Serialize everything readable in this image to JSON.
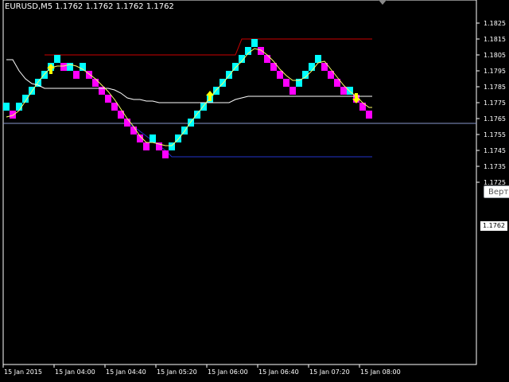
{
  "window": {
    "title": "EURUSD,M5  1.1762 1.1762 1.1762 1.1762",
    "current_price_label": "1.1762",
    "tooltip_text": "Верт"
  },
  "colors": {
    "background": "#000000",
    "axis": "#ffffff",
    "bull_brick": "#00ffff",
    "bear_brick": "#ff00ff",
    "ma_line": "#ffff66",
    "channel_line": "#ffffff",
    "resistance_line": "#cc0000",
    "support_line": "#2233cc",
    "current_price_line": "#8899cc",
    "arrow": "#ffff00"
  },
  "icons": {
    "up_arrow": "up-arrow-icon",
    "down_arrow": "down-arrow-icon",
    "scroll_marker": "scroll-triangle-icon"
  },
  "chart_data": {
    "type": "renko",
    "symbol": "EURUSD",
    "timeframe": "M5",
    "brick_size": 0.0005,
    "ylim": [
      1.1719,
      1.1829
    ],
    "y_ticks": [
      "1.1825",
      "1.1815",
      "1.1805",
      "1.1795",
      "1.1785",
      "1.1775",
      "1.1765",
      "1.1755",
      "1.1745",
      "1.1735",
      "1.1725"
    ],
    "x_ticks": [
      "15 Jan 2015",
      "15 Jan 04:00",
      "15 Jan 04:40",
      "15 Jan 05:20",
      "15 Jan 06:00",
      "15 Jan 06:40",
      "15 Jan 07:20",
      "15 Jan 08:00"
    ],
    "current_price": 1.1762,
    "bricks": [
      {
        "dir": "up",
        "low": 1.177,
        "high": 1.1775
      },
      {
        "dir": "down",
        "low": 1.1765,
        "high": 1.177
      },
      {
        "dir": "up",
        "low": 1.177,
        "high": 1.1775
      },
      {
        "dir": "up",
        "low": 1.1775,
        "high": 1.178
      },
      {
        "dir": "up",
        "low": 1.178,
        "high": 1.1785
      },
      {
        "dir": "up",
        "low": 1.1785,
        "high": 1.179
      },
      {
        "dir": "up",
        "low": 1.179,
        "high": 1.1795
      },
      {
        "dir": "up",
        "low": 1.1795,
        "high": 1.18
      },
      {
        "dir": "up",
        "low": 1.18,
        "high": 1.1805
      },
      {
        "dir": "down",
        "low": 1.1795,
        "high": 1.18
      },
      {
        "dir": "up",
        "low": 1.1795,
        "high": 1.18
      },
      {
        "dir": "down",
        "low": 1.179,
        "high": 1.1795
      },
      {
        "dir": "up",
        "low": 1.1795,
        "high": 1.18
      },
      {
        "dir": "down",
        "low": 1.179,
        "high": 1.1795
      },
      {
        "dir": "down",
        "low": 1.1785,
        "high": 1.179
      },
      {
        "dir": "down",
        "low": 1.178,
        "high": 1.1785
      },
      {
        "dir": "down",
        "low": 1.1775,
        "high": 1.178
      },
      {
        "dir": "down",
        "low": 1.177,
        "high": 1.1775
      },
      {
        "dir": "down",
        "low": 1.1765,
        "high": 1.177
      },
      {
        "dir": "down",
        "low": 1.176,
        "high": 1.1765
      },
      {
        "dir": "down",
        "low": 1.1755,
        "high": 1.176
      },
      {
        "dir": "down",
        "low": 1.175,
        "high": 1.1755
      },
      {
        "dir": "down",
        "low": 1.1745,
        "high": 1.175
      },
      {
        "dir": "up",
        "low": 1.175,
        "high": 1.1755
      },
      {
        "dir": "down",
        "low": 1.1745,
        "high": 1.175
      },
      {
        "dir": "down",
        "low": 1.174,
        "high": 1.1745
      },
      {
        "dir": "up",
        "low": 1.1745,
        "high": 1.175
      },
      {
        "dir": "up",
        "low": 1.175,
        "high": 1.1755
      },
      {
        "dir": "up",
        "low": 1.1755,
        "high": 1.176
      },
      {
        "dir": "up",
        "low": 1.176,
        "high": 1.1765
      },
      {
        "dir": "up",
        "low": 1.1765,
        "high": 1.177
      },
      {
        "dir": "up",
        "low": 1.177,
        "high": 1.1775
      },
      {
        "dir": "up",
        "low": 1.1775,
        "high": 1.178
      },
      {
        "dir": "up",
        "low": 1.178,
        "high": 1.1785
      },
      {
        "dir": "up",
        "low": 1.1785,
        "high": 1.179
      },
      {
        "dir": "up",
        "low": 1.179,
        "high": 1.1795
      },
      {
        "dir": "up",
        "low": 1.1795,
        "high": 1.18
      },
      {
        "dir": "up",
        "low": 1.18,
        "high": 1.1805
      },
      {
        "dir": "up",
        "low": 1.1805,
        "high": 1.181
      },
      {
        "dir": "up",
        "low": 1.181,
        "high": 1.1815
      },
      {
        "dir": "down",
        "low": 1.1805,
        "high": 1.181
      },
      {
        "dir": "down",
        "low": 1.18,
        "high": 1.1805
      },
      {
        "dir": "down",
        "low": 1.1795,
        "high": 1.18
      },
      {
        "dir": "down",
        "low": 1.179,
        "high": 1.1795
      },
      {
        "dir": "down",
        "low": 1.1785,
        "high": 1.179
      },
      {
        "dir": "down",
        "low": 1.178,
        "high": 1.1785
      },
      {
        "dir": "up",
        "low": 1.1785,
        "high": 1.179
      },
      {
        "dir": "up",
        "low": 1.179,
        "high": 1.1795
      },
      {
        "dir": "up",
        "low": 1.1795,
        "high": 1.18
      },
      {
        "dir": "up",
        "low": 1.18,
        "high": 1.1805
      },
      {
        "dir": "down",
        "low": 1.1795,
        "high": 1.18
      },
      {
        "dir": "down",
        "low": 1.179,
        "high": 1.1795
      },
      {
        "dir": "down",
        "low": 1.1785,
        "high": 1.179
      },
      {
        "dir": "down",
        "low": 1.178,
        "high": 1.1785
      },
      {
        "dir": "up",
        "low": 1.178,
        "high": 1.1785
      },
      {
        "dir": "down",
        "low": 1.1775,
        "high": 1.178
      },
      {
        "dir": "down",
        "low": 1.177,
        "high": 1.1775
      },
      {
        "dir": "down",
        "low": 1.1765,
        "high": 1.177
      }
    ],
    "ma": [
      1.1766,
      1.1767,
      1.177,
      1.1776,
      1.1782,
      1.1788,
      1.1793,
      1.1797,
      1.1798,
      1.1798,
      1.1799,
      1.1798,
      1.1796,
      1.1793,
      1.179,
      1.1786,
      1.1782,
      1.1777,
      1.1771,
      1.1765,
      1.176,
      1.1754,
      1.175,
      1.175,
      1.1749,
      1.1748,
      1.1748,
      1.1752,
      1.1757,
      1.1763,
      1.1768,
      1.1773,
      1.1778,
      1.1783,
      1.1787,
      1.1792,
      1.1797,
      1.1801,
      1.1806,
      1.1809,
      1.1808,
      1.1805,
      1.1801,
      1.1796,
      1.1792,
      1.1789,
      1.1789,
      1.1791,
      1.1795,
      1.18,
      1.1801,
      1.1796,
      1.1791,
      1.1786,
      1.1782,
      1.1779,
      1.1775,
      1.1772
    ],
    "channel_upper": [
      1.1831,
      null,
      null,
      null,
      null,
      null,
      1.1805,
      1.1805,
      1.1805,
      1.1805,
      1.1805,
      1.1805,
      1.1805,
      1.1805,
      1.1805,
      1.1805,
      1.1805,
      1.1805,
      1.1805,
      1.1805,
      1.1805,
      1.1805,
      1.1805,
      1.1805,
      1.1805,
      1.1805,
      1.1805,
      1.1805,
      1.1805,
      1.1805,
      1.1805,
      1.1805,
      1.1805,
      1.1805,
      1.1805,
      1.1805,
      1.1805,
      1.1815,
      1.1815,
      1.1815,
      1.1815,
      1.1815,
      1.1815,
      1.1815,
      1.1815,
      1.1815,
      1.1815,
      1.1815,
      1.1815,
      1.1815,
      1.1815,
      1.1815,
      1.1815,
      1.1815,
      1.1815,
      1.1815,
      1.1815,
      1.1815
    ],
    "channel_lower": [
      1.1762,
      1.1762,
      1.1762,
      1.1762,
      1.1762,
      1.1762,
      1.1762,
      1.1762,
      1.1762,
      1.1762,
      1.1762,
      1.1762,
      1.1762,
      1.1762,
      1.1762,
      1.1762,
      1.1762,
      1.1762,
      1.1762,
      1.1762,
      1.176,
      1.1757,
      1.1754,
      1.1751,
      1.1748,
      1.1745,
      1.1741,
      1.1741,
      1.1741,
      1.1741,
      1.1741,
      1.1741,
      1.1741,
      1.1741,
      1.1741,
      1.1741,
      1.1741,
      1.1741,
      1.1741,
      1.1741,
      1.1741,
      1.1741,
      1.1741,
      1.1741,
      1.1741,
      1.1741,
      1.1741,
      1.1741,
      1.1741,
      1.1741,
      1.1741,
      1.1741,
      1.1741,
      1.1741,
      1.1741,
      1.1741,
      1.1741,
      1.1741
    ],
    "trail_line": [
      1.1802,
      1.1802,
      1.1795,
      1.179,
      1.1787,
      1.1786,
      1.1784,
      1.1784,
      1.1784,
      1.1784,
      1.1784,
      1.1784,
      1.1784,
      1.1784,
      1.1784,
      1.1784,
      1.1784,
      1.1783,
      1.1781,
      1.1778,
      1.1777,
      1.1777,
      1.1776,
      1.1776,
      1.1775,
      1.1775,
      1.1775,
      1.1775,
      1.1775,
      1.1775,
      1.1775,
      1.1775,
      1.1775,
      1.1775,
      1.1775,
      1.1775,
      1.1777,
      1.1778,
      1.1779,
      1.1779,
      1.1779,
      1.1779,
      1.1779,
      1.1779,
      1.1779,
      1.1779,
      1.1779,
      1.1779,
      1.1779,
      1.1779,
      1.1779,
      1.1779,
      1.1779,
      1.1779,
      1.1779,
      1.1779,
      1.1779,
      1.1779
    ],
    "arrows": [
      {
        "brick": 7,
        "dir": "up",
        "price": 1.1796
      },
      {
        "brick": 32,
        "dir": "up",
        "price": 1.1779
      },
      {
        "brick": 55,
        "dir": "down",
        "price": 1.1778
      }
    ]
  }
}
